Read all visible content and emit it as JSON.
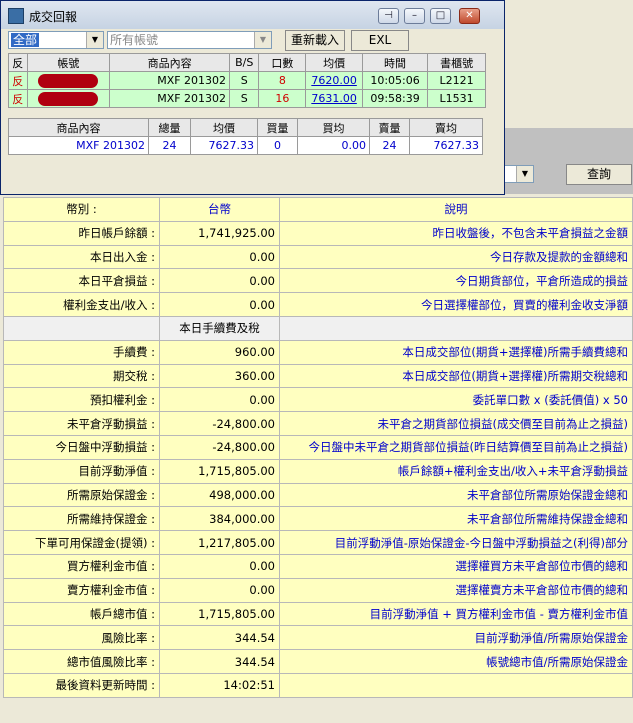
{
  "window": {
    "title": "成交回報"
  },
  "toolbar": {
    "group_value": "全部",
    "account_placeholder": "所有帳號",
    "reload_label": "重新載入",
    "excel_label": "EXL"
  },
  "trades": {
    "headers": [
      "反",
      "帳號",
      "商品內容",
      "B/S",
      "口數",
      "均價",
      "時間",
      "書櫃號"
    ],
    "rows": [
      {
        "flag": "反",
        "account": "",
        "product": "MXF 201302",
        "bs": "S",
        "qty": "8",
        "price": "7620.00",
        "time": "10:05:06",
        "book": "L2121"
      },
      {
        "flag": "反",
        "account": "",
        "product": "MXF 201302",
        "bs": "S",
        "qty": "16",
        "price": "7631.00",
        "time": "09:58:39",
        "book": "L1531"
      }
    ]
  },
  "positions": {
    "headers": [
      "商品內容",
      "總量",
      "均價",
      "買量",
      "買均",
      "賣量",
      "賣均"
    ],
    "rows": [
      {
        "product": "MXF 201302",
        "total": "24",
        "avg": "7627.33",
        "buy_qty": "0",
        "buy_avg": "0.00",
        "sell_qty": "24",
        "sell_avg": "7627.33"
      }
    ]
  },
  "query_label": "查詢",
  "summary": {
    "header": {
      "label": "幣別 :",
      "value": "台幣",
      "desc": "說明"
    },
    "rows": [
      {
        "label": "昨日帳戶餘額 :",
        "value": "1,741,925.00",
        "desc": "昨日收盤後，不包含未平倉損益之金額"
      },
      {
        "label": "本日出入金 :",
        "value": "0.00",
        "desc": "今日存款及提款的金額總和"
      },
      {
        "label": "本日平倉損益 :",
        "value": "0.00",
        "desc": "今日期貨部位，平倉所造成的損益"
      },
      {
        "label": "權利金支出/收入 :",
        "value": "0.00",
        "desc": "今日選擇權部位，買賣的權利金收支淨額"
      },
      {
        "label": "",
        "value": "本日手續費及稅",
        "desc": ""
      },
      {
        "label": "手續費 :",
        "value": "960.00",
        "desc": "本日成交部位(期貨+選擇權)所需手續費總和"
      },
      {
        "label": "期交稅 :",
        "value": "360.00",
        "desc": "本日成交部位(期貨+選擇權)所需期交稅總和"
      },
      {
        "label": "預扣權利金 :",
        "value": "0.00",
        "desc": "委託單口數 x (委託價值) x 50"
      },
      {
        "label": "未平倉浮動損益 :",
        "value": "-24,800.00",
        "desc": "未平倉之期貨部位損益(成交價至目前為止之損益)"
      },
      {
        "label": "今日盤中浮動損益 :",
        "value": "-24,800.00",
        "desc": "今日盤中未平倉之期貨部位損益(昨日結算價至目前為止之損益)"
      },
      {
        "label": "目前浮動淨值 :",
        "value": "1,715,805.00",
        "desc": "帳戶餘額+權利金支出/收入+未平倉浮動損益"
      },
      {
        "label": "所需原始保證金 :",
        "value": "498,000.00",
        "desc": "未平倉部位所需原始保證金總和"
      },
      {
        "label": "所需維持保證金 :",
        "value": "384,000.00",
        "desc": "未平倉部位所需維持保證金總和"
      },
      {
        "label": "下單可用保證金(提領) :",
        "value": "1,217,805.00",
        "desc": "目前浮動淨值-原始保證金-今日盤中浮動損益之(利得)部分"
      },
      {
        "label": "買方權利金市值 :",
        "value": "0.00",
        "desc": "選擇權買方未平倉部位市價的總和"
      },
      {
        "label": "賣方權利金市值 :",
        "value": "0.00",
        "desc": "選擇權賣方未平倉部位市價的總和"
      },
      {
        "label": "帳戶總市值 :",
        "value": "1,715,805.00",
        "desc": "目前浮動淨值 + 買方權利金市值 - 賣方權利金市值"
      },
      {
        "label": "風險比率 :",
        "value": "344.54",
        "desc": "目前浮動淨值/所需原始保證金"
      },
      {
        "label": "總市值風險比率 :",
        "value": "344.54",
        "desc": "帳號總市值/所需原始保證金"
      },
      {
        "label": "最後資料更新時間 :",
        "value": "14:02:51",
        "desc": ""
      }
    ]
  }
}
